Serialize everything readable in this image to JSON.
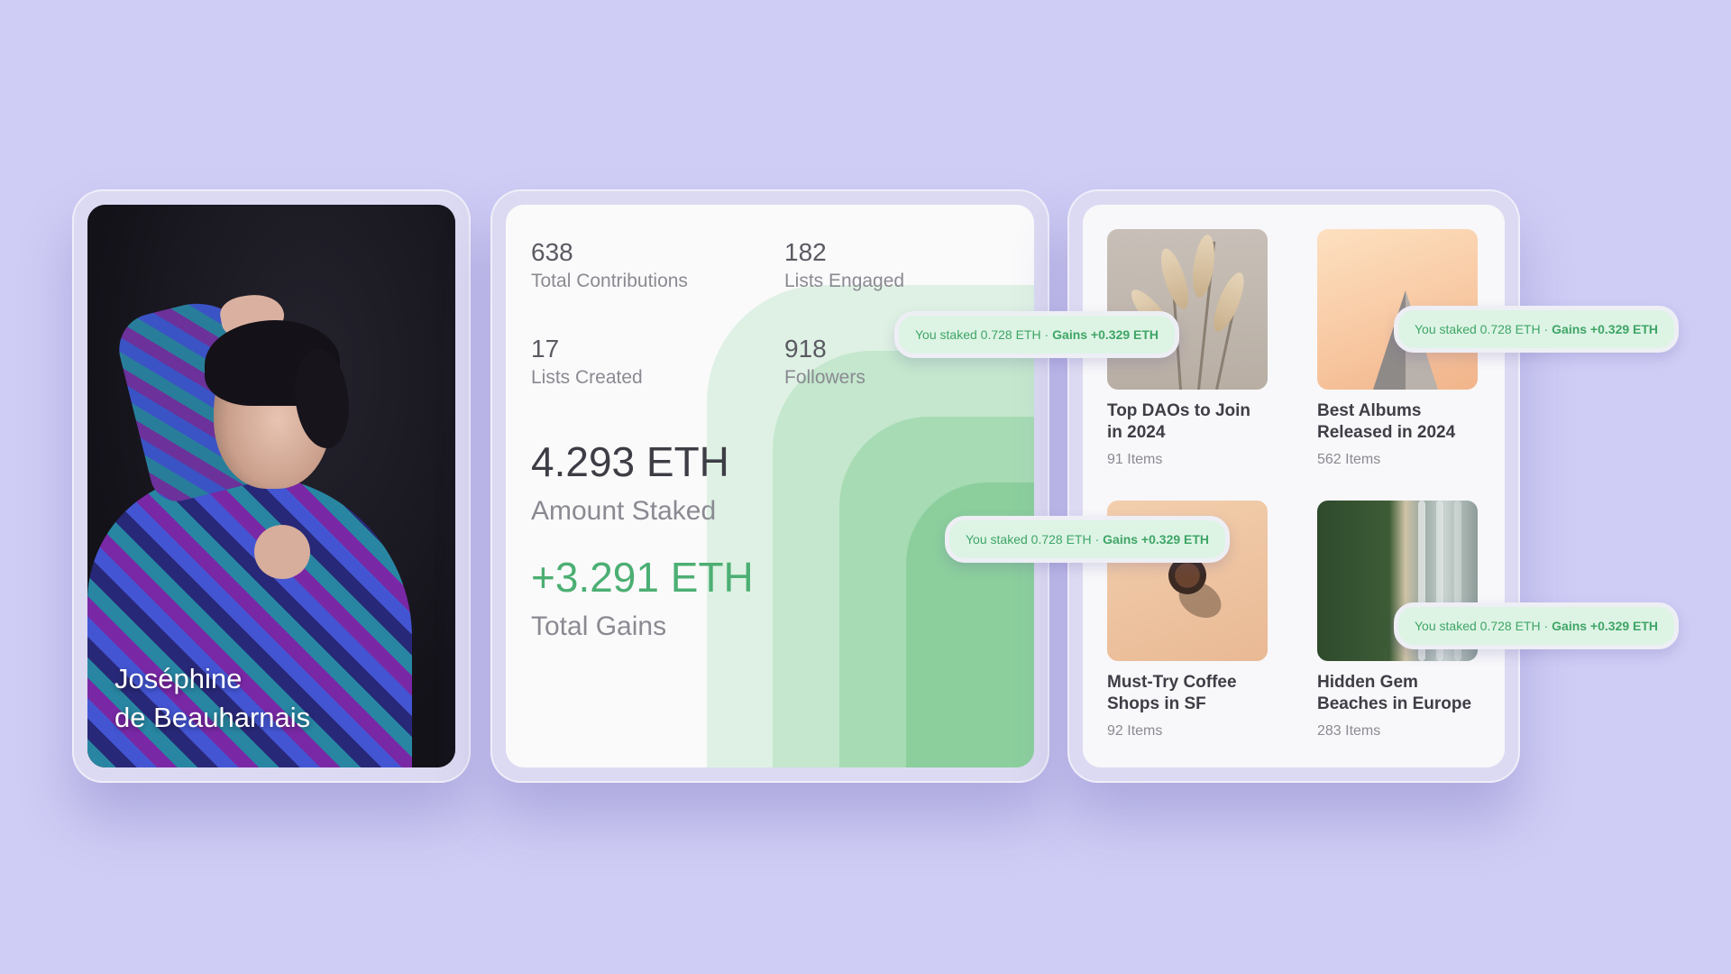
{
  "profile": {
    "name_line1": "Joséphine",
    "name_line2": "de Beauharnais"
  },
  "stats": {
    "contributions": {
      "value": "638",
      "label": "Total Contributions"
    },
    "engaged": {
      "value": "182",
      "label": "Lists Engaged"
    },
    "created": {
      "value": "17",
      "label": "Lists Created"
    },
    "followers": {
      "value": "918",
      "label": "Followers"
    },
    "staked": {
      "value": "4.293 ETH",
      "label": "Amount Staked"
    },
    "gains": {
      "value": "+3.291 ETH",
      "label": "Total Gains"
    }
  },
  "lists": [
    {
      "title": "Top DAOs to Join in 2024",
      "count": "91 Items"
    },
    {
      "title": "Best Albums Released in 2024",
      "count": "562 Items"
    },
    {
      "title": "Must-Try Coffee Shops in SF",
      "count": "92 Items"
    },
    {
      "title": "Hidden Gem Beaches in Europe",
      "count": "283 Items"
    }
  ],
  "tooltips": [
    {
      "staked": "You staked 0.728 ETH ·",
      "gains": "Gains +0.329 ETH"
    },
    {
      "staked": "You staked 0.728 ETH ·",
      "gains": "Gains +0.329 ETH"
    },
    {
      "staked": "You staked 0.728 ETH ·",
      "gains": "Gains +0.329 ETH"
    },
    {
      "staked": "You staked 0.728 ETH ·",
      "gains": "Gains +0.329 ETH"
    }
  ],
  "colors": {
    "background": "#cfcdf5",
    "accent_green": "#4caf73",
    "tooltip_bg": "#ddf4e5"
  }
}
